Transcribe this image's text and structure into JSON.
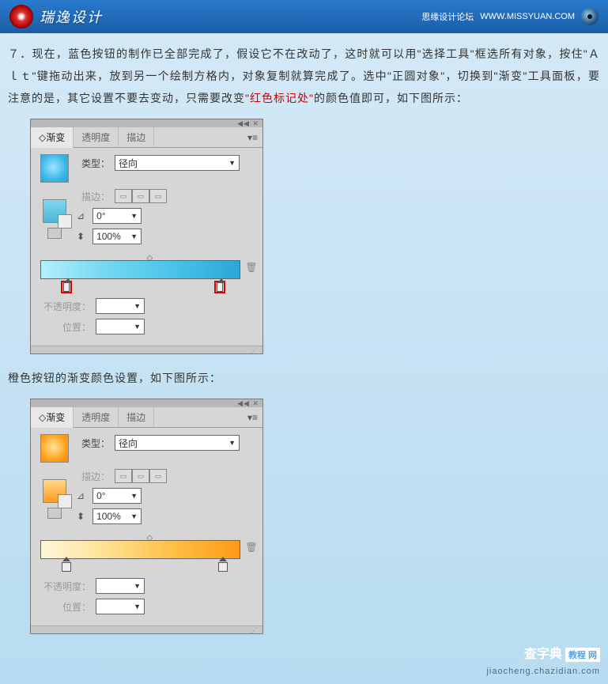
{
  "header": {
    "title": "瑞逸设计",
    "forum_text": "思缘设计论坛",
    "forum_url": "WWW.MISSYUAN.COM"
  },
  "body": {
    "para1_prefix": "７．现在，蓝色按钮的制作已全部完成了，假设它不在改动了，这时就可以用\"选择工具\"框选所有对象，按住\"Ａｌｔ\"键拖动出来，放到另一个绘制方格内，对象复制就算完成了。选中\"正圆对象\"，切换到\"渐变\"工具面板，要注意的是，其它设置不要去变动，只需要改变",
    "para1_red": "\"红色标记处\"",
    "para1_suffix": "的颜色值即可，如下图所示：",
    "para2": "橙色按钮的渐变颜色设置，如下图所示："
  },
  "panel_common": {
    "tabs": [
      "渐变",
      "透明度",
      "描边"
    ],
    "type_label": "类型：",
    "type_value": "径向",
    "stroke_label": "描边：",
    "angle_value": "0°",
    "aspect_value": "100%",
    "opacity_label": "不透明度：",
    "position_label": "位置："
  },
  "watermark": {
    "brand": "查字典",
    "suffix": "教程 网",
    "url": "jiaocheng.chazidian.com"
  }
}
